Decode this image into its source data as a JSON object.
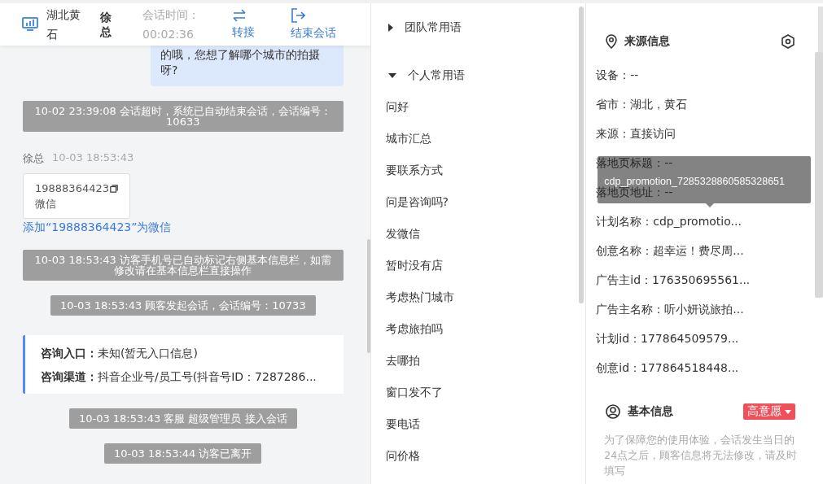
{
  "header": {
    "location": "湖北黄石",
    "customer": "徐总",
    "timer_label": "会话时间：",
    "timer": "00:02:36",
    "actions": [
      {
        "kind": "transfer",
        "label": "转接"
      },
      {
        "kind": "end",
        "label": "结束会话"
      }
    ]
  },
  "messages": [
    {
      "kind": "agent_bubble",
      "text": "的哦，您想了解哪个城市的拍摄呀?"
    },
    {
      "kind": "system",
      "text": "10-02 23:39:08 会话超时，系统已自动结束会话，会话编号：10633"
    },
    {
      "kind": "contact_card",
      "sender": "徐总",
      "time": "10-03 18:53:43",
      "phone": "19888364423",
      "type": "微信",
      "link": "添加“19888364423”为微信"
    },
    {
      "kind": "system",
      "text": "10-03 18:53:43 访客手机号已自动标记右侧基本信息栏，如需修改请在基本信息栏直接操作"
    },
    {
      "kind": "system",
      "text": "10-03 18:53:43 顾客发起会话，会话编号：10733"
    },
    {
      "kind": "info_card",
      "rows": [
        {
          "label": "咨询入口：",
          "value": "未知(暂无入口信息)"
        },
        {
          "label": "咨询渠道：",
          "value": "抖音企业号/员工号(抖音号ID：7287286..."
        }
      ]
    },
    {
      "kind": "system",
      "text": "10-03 18:53:43 客服 超级管理员 接入会话"
    },
    {
      "kind": "system",
      "text": "10-03 18:53:44 访客已离开"
    }
  ],
  "phrases": [
    {
      "label": "团队常用语",
      "expanded": false
    },
    {
      "label": "个人常用语",
      "expanded": true,
      "children": [
        {
          "label": "问好"
        },
        {
          "label": "城市汇总"
        },
        {
          "label": "要联系方式"
        },
        {
          "label": "问是咨询吗?"
        },
        {
          "label": "发微信"
        },
        {
          "label": "暂时没有店"
        },
        {
          "label": "考虑热门城市"
        },
        {
          "label": "考虑旅拍吗"
        },
        {
          "label": "去哪拍"
        },
        {
          "label": "窗口发不了"
        },
        {
          "label": "要电话"
        },
        {
          "label": "问价格"
        }
      ]
    }
  ],
  "source_info": {
    "title": "来源信息",
    "rows": [
      "设备：--",
      "省市：湖北，黄石",
      "来源：直接访问",
      "落地页标题：--",
      "落地页地址：--",
      "计划名称：cdp_promotio...",
      "创意名称：超幸运！费尽周...",
      "广告主id：176350695561...",
      "广告主名称：听小妍说旅拍...",
      "计划id：177864509579...",
      "创意id：177864518448..."
    ]
  },
  "tooltip": {
    "text": "cdp_promotion_7285328860585328651"
  },
  "basic_info": {
    "title": "基本信息",
    "intent": "高意愿",
    "note": "为了保障您的使用体验，会话发生当日的24点之后，顾客信息将无法修改，请及时填写"
  }
}
